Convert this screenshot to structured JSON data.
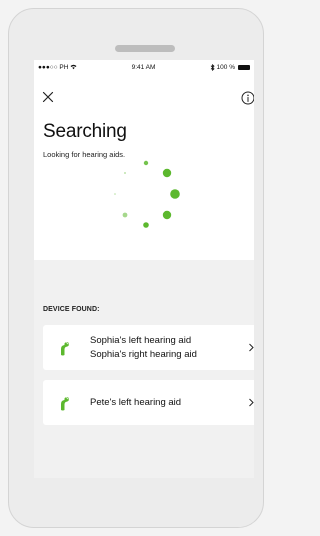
{
  "status_bar": {
    "carrier": "●●●○○ PH",
    "time": "9:41 AM",
    "battery": "100 %"
  },
  "header": {
    "close_icon": "close-icon",
    "info_icon": "info-icon"
  },
  "title": "Searching",
  "subtitle": "Looking for hearing aids.",
  "spinner": {
    "accent_color": "#5cb82e"
  },
  "section_label": "DEVICE FOUND:",
  "devices": [
    {
      "names": [
        "Sophia's left hearing aid",
        "Sophia's right hearing aid"
      ],
      "icon": "hearing-aid-icon"
    },
    {
      "names": [
        "Pete's left hearing aid"
      ],
      "icon": "hearing-aid-icon"
    }
  ]
}
